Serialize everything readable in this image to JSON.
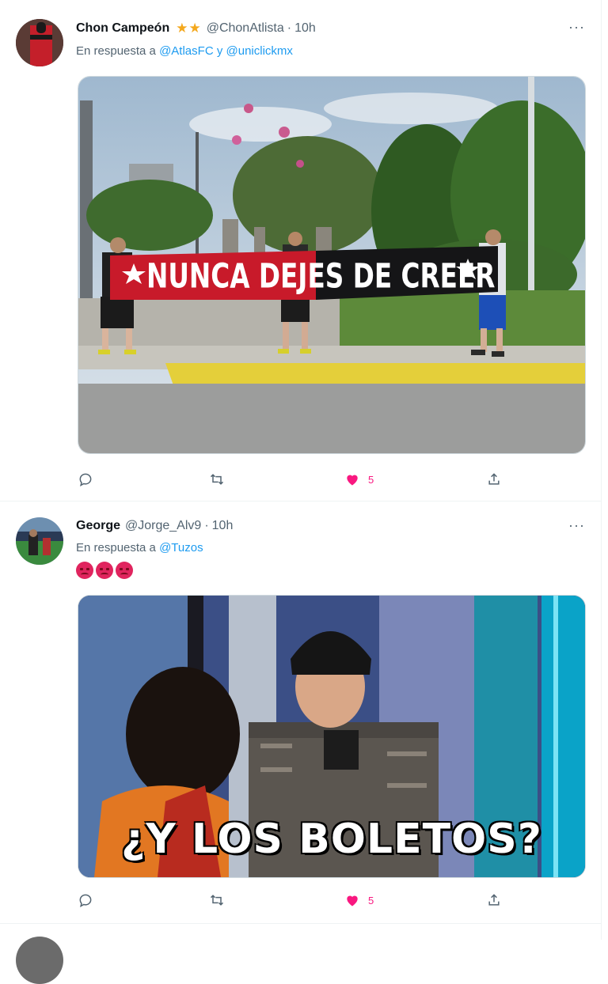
{
  "tweets": [
    {
      "name": "Chon Campeón",
      "badges": "★★",
      "handle": "@ChonAtlista",
      "separator": "·",
      "time": "10h",
      "more": "···",
      "reply_prefix": "En respuesta a",
      "mention_1": "@AtlasFC",
      "conjunction": "y",
      "mention_2": "@uniclickmx",
      "media_banner_text": "NUNCA DEJES DE CREER",
      "actions": {
        "reply": "reply-icon",
        "retweet": "retweet-icon",
        "like": "heart-icon",
        "like_count": "5",
        "share": "share-icon"
      }
    },
    {
      "name": "George",
      "handle": "@Jorge_Alv9",
      "separator": "·",
      "time": "10h",
      "more": "···",
      "reply_prefix": "En respuesta a",
      "mention_1": "@Tuzos",
      "emojis": [
        "angry-face",
        "angry-face",
        "angry-face"
      ],
      "media_caption": "¿Y LOS BOLETOS?",
      "actions": {
        "reply": "reply-icon",
        "retweet": "retweet-icon",
        "like": "heart-icon",
        "like_count": "5",
        "share": "share-icon"
      }
    }
  ],
  "colors": {
    "like_active": "#f91880",
    "mention": "#1d9bf0",
    "secondary_text": "#536471",
    "star": "#f4a81d"
  }
}
